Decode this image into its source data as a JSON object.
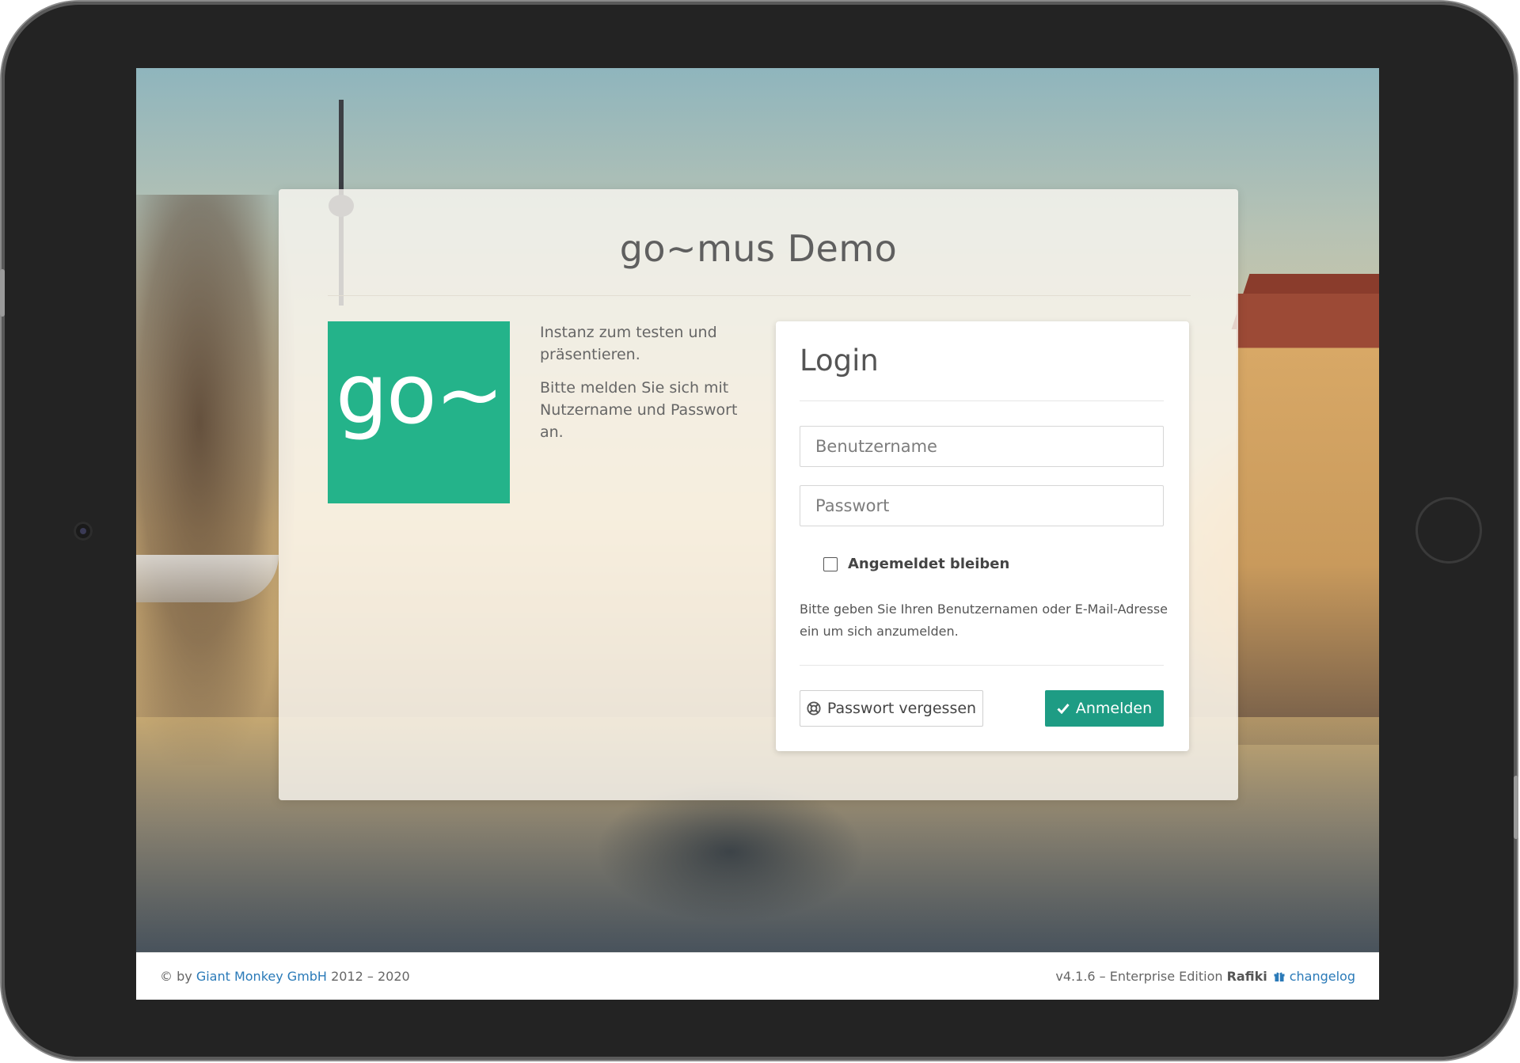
{
  "panel": {
    "title": "go~mus Demo",
    "logo_text": "go~",
    "description": [
      "Instanz zum testen und präsentieren.",
      "Bitte melden Sie sich mit Nutzername und Passwort an."
    ]
  },
  "login": {
    "title": "Login",
    "username_placeholder": "Benutzername",
    "password_placeholder": "Passwort",
    "remember_label": "Angemeldet bleiben",
    "remember_checked": false,
    "hint": "Bitte geben Sie Ihren Benutzernamen oder E-Mail-Adresse ein um sich anzumelden.",
    "forgot_label": "Passwort vergessen",
    "submit_label": "Anmelden",
    "accent_color": "#1e9c84"
  },
  "footer": {
    "copyright_prefix": "© by",
    "company": "Giant Monkey GmbH",
    "years": "2012 – 2020",
    "version_text": "v4.1.6 – Enterprise Edition",
    "edition_name": "Rafiki",
    "changelog_label": "changelog",
    "link_color": "#2a7ab8"
  },
  "icons": {
    "forgot": "lifebuoy-icon",
    "submit": "check-icon",
    "changelog": "gift-icon"
  }
}
